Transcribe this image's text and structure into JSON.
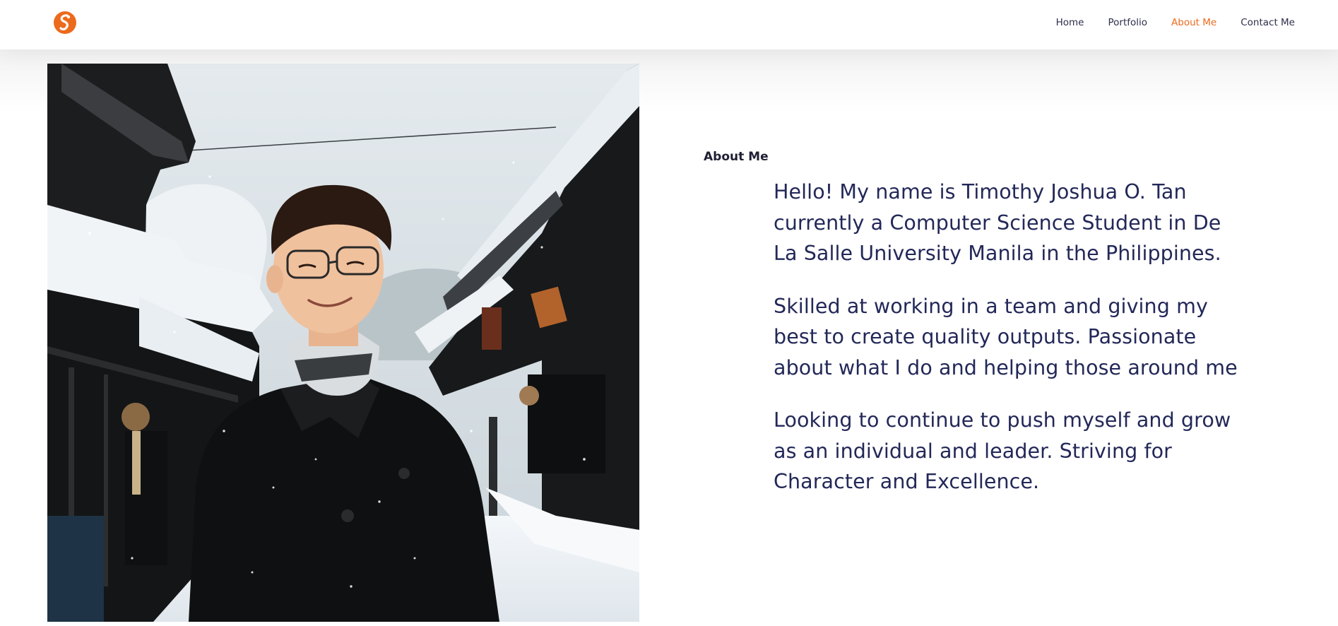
{
  "header": {
    "logo_icon": "swirl-s-logo-icon",
    "accent_color": "#ec6a1c",
    "nav": [
      {
        "label": "Home",
        "active": false
      },
      {
        "label": "Portfolio",
        "active": false
      },
      {
        "label": "About Me",
        "active": true
      },
      {
        "label": "Contact Me",
        "active": false
      }
    ]
  },
  "about": {
    "heading": "About Me",
    "paragraphs": [
      "Hello! My name is Timothy Joshua O. Tan currently a Computer Science Student in De La Salle University Manila in the Philippines.",
      "Skilled at working in a team and giving my best to create quality outputs. Passionate about what I do and helping those around me",
      "Looking to continue to push myself and grow as an individual and leader. Striving for Character and Excellence."
    ],
    "text_color": "#232858"
  }
}
